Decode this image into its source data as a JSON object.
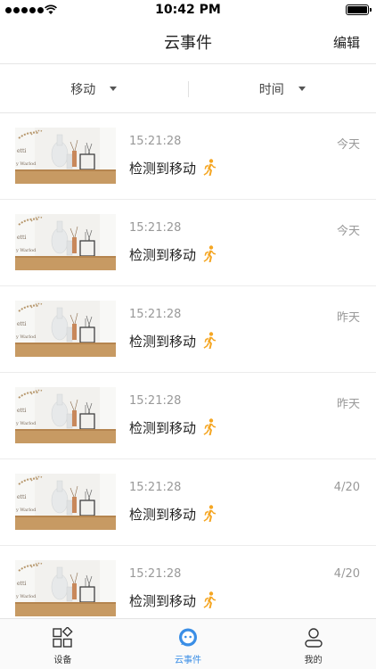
{
  "status_bar": {
    "time": "10:42 PM"
  },
  "nav": {
    "title": "云事件",
    "edit_label": "编辑"
  },
  "filters": [
    {
      "label": "移动"
    },
    {
      "label": "时间"
    }
  ],
  "events": [
    {
      "time": "15:21:28",
      "day": "今天",
      "label": "检测到移动"
    },
    {
      "time": "15:21:28",
      "day": "今天",
      "label": "检测到移动"
    },
    {
      "time": "15:21:28",
      "day": "昨天",
      "label": "检测到移动"
    },
    {
      "time": "15:21:28",
      "day": "昨天",
      "label": "检测到移动"
    },
    {
      "time": "15:21:28",
      "day": "4/20",
      "label": "检测到移动"
    },
    {
      "time": "15:21:28",
      "day": "4/20",
      "label": "检测到移动"
    }
  ],
  "tabs": [
    {
      "label": "设备",
      "icon": "devices-grid-icon",
      "active": false
    },
    {
      "label": "云事件",
      "icon": "cloud-chat-icon",
      "active": true
    },
    {
      "label": "我的",
      "icon": "person-icon",
      "active": false
    }
  ],
  "colors": {
    "accent": "#3a8ee6",
    "motion_icon": "#f5a623",
    "thumbnail_table": "#c79a63"
  }
}
